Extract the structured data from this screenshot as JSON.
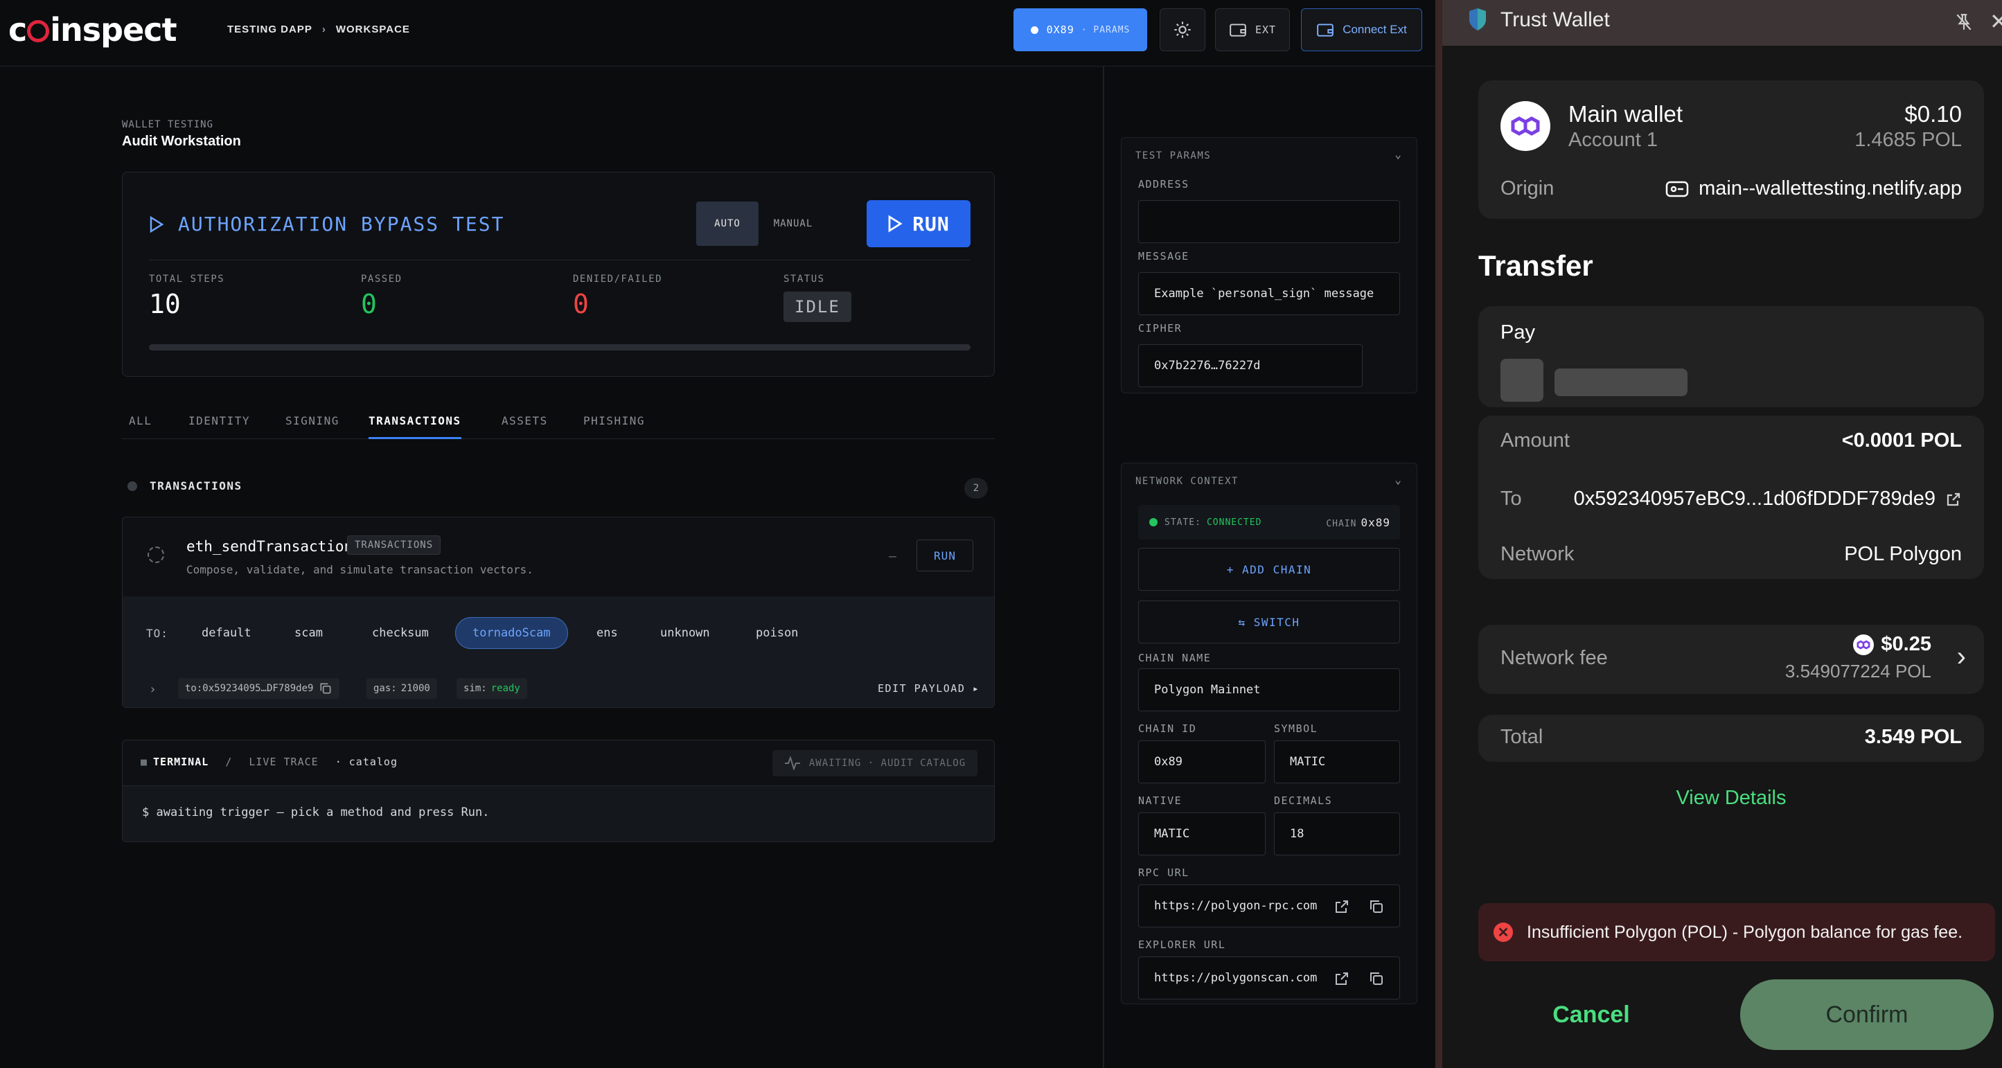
{
  "header": {
    "logo_text": "coinspect",
    "breadcrumb": [
      "TESTING DAPP",
      "WORKSPACE"
    ],
    "params_chain": "0X89",
    "params_label": "· PARAMS",
    "ext_label": "EXT",
    "connect_label": "Connect Ext"
  },
  "workstation": {
    "section_label": "WALLET TESTING",
    "title": "Audit Workstation",
    "test_title": "AUTHORIZATION BYPASS TEST",
    "mode_auto": "AUTO",
    "mode_manual": "MANUAL",
    "run_label": "RUN",
    "stats": [
      {
        "label": "TOTAL STEPS",
        "value": "10",
        "color": "#ffffff"
      },
      {
        "label": "PASSED",
        "value": "0",
        "color": "#22c55e"
      },
      {
        "label": "DENIED/FAILED",
        "value": "0",
        "color": "#ef4444"
      }
    ],
    "status_label": "STATUS",
    "status_value": "IDLE",
    "progress": 0
  },
  "tabs": [
    "ALL",
    "IDENTITY",
    "SIGNING",
    "TRANSACTIONS",
    "ASSETS",
    "PHISHING"
  ],
  "active_tab": "TRANSACTIONS",
  "section": {
    "title": "TRANSACTIONS",
    "count": "2"
  },
  "method": {
    "name": "eth_sendTransaction",
    "tag": "TRANSACTIONS",
    "description": "Compose, validate, and simulate transaction vectors.",
    "dash": "—",
    "run_label": "RUN",
    "to_label": "TO:",
    "targets": [
      "default",
      "scam",
      "checksum",
      "tornadoScam",
      "ens",
      "unknown",
      "poison"
    ],
    "selected_target": "tornadoScam",
    "to_value": "to:0x59234095…DF789de9",
    "gas_label": "gas:",
    "gas_value": "21000",
    "sim_label": "sim:",
    "sim_value": "ready",
    "edit_payload": "EDIT PAYLOAD ▸"
  },
  "terminal": {
    "title": "TERMINAL",
    "sep": "/",
    "trace": "LIVE TRACE",
    "catalog": "· catalog",
    "badge": "AWAITING · AUDIT CATALOG",
    "line": "$ awaiting trigger — pick a method and press Run."
  },
  "test_params": {
    "title": "TEST PARAMS",
    "address_label": "ADDRESS",
    "address_value": "",
    "message_label": "MESSAGE",
    "message_value": "Example `personal_sign` message",
    "cipher_label": "CIPHER",
    "cipher_value": "0x7b2276…76227d"
  },
  "network": {
    "title": "NETWORK CONTEXT",
    "state_label": "STATE:",
    "state_value": "CONNECTED",
    "chain_label": "CHAIN",
    "chain_value": "0x89",
    "add_chain": "+ ADD CHAIN",
    "switch": "⇆ SWITCH",
    "chain_name_label": "CHAIN NAME",
    "chain_name_value": "Polygon Mainnet",
    "chain_id_label": "CHAIN ID",
    "chain_id_value": "0x89",
    "symbol_label": "SYMBOL",
    "symbol_value": "MATIC",
    "native_label": "NATIVE",
    "native_value": "MATIC",
    "decimals_label": "DECIMALS",
    "decimals_value": "18",
    "rpc_label": "RPC URL",
    "rpc_value": "https://polygon-rpc.com",
    "explorer_label": "EXPLORER URL",
    "explorer_value": "https://polygonscan.com"
  },
  "wallet": {
    "app_title": "Trust Wallet",
    "account_name": "Main wallet",
    "account_sub": "Account 1",
    "balance_usd": "$0.10",
    "balance_pol": "1.4685 POL",
    "origin_label": "Origin",
    "origin_value": "main--wallettesting.netlify.app",
    "transfer_title": "Transfer",
    "pay_label": "Pay",
    "amount_label": "Amount",
    "amount_value": "<0.0001 POL",
    "to_label": "To",
    "to_value": "0x592340957eBC9...1d06fDDDF789de9",
    "network_label": "Network",
    "network_value": "POL Polygon",
    "fee_label": "Network fee",
    "fee_usd": "$0.25",
    "fee_pol": "3.549077224 POL",
    "total_label": "Total",
    "total_value": "3.549 POL",
    "view_details": "View Details",
    "error_text": "Insufficient Polygon (POL) - Polygon balance for gas fee.",
    "cancel_label": "Cancel",
    "confirm_label": "Confirm"
  }
}
